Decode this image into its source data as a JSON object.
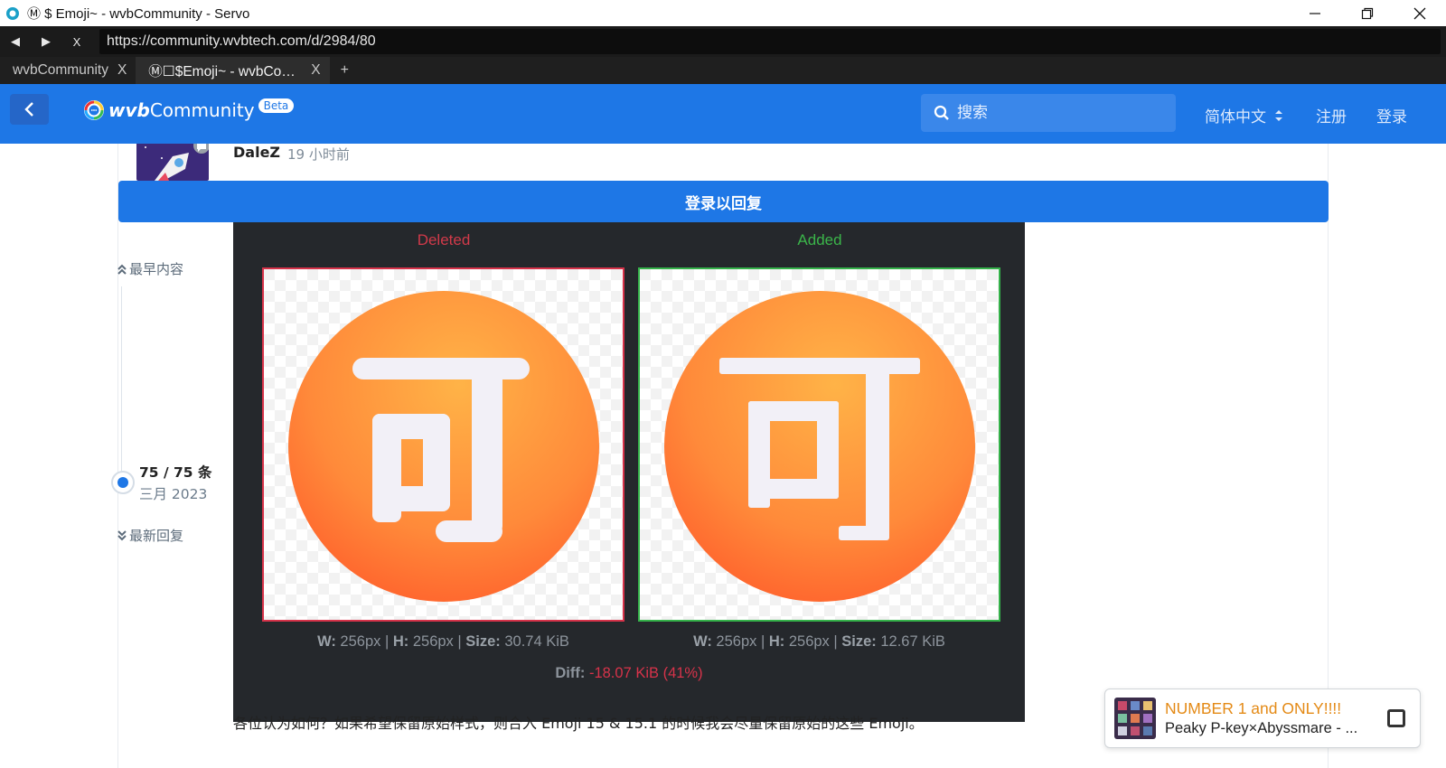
{
  "window": {
    "title": "Ⓜ $ Emoji~ - wvbCommunity - Servo"
  },
  "toolbar": {
    "back": "◀",
    "forward": "▶",
    "stop": "X",
    "url": "https://community.wvbtech.com/d/2984/80"
  },
  "tabs": [
    {
      "label": "wvbCommunity",
      "close": "X",
      "active": false
    },
    {
      "label": "Ⓜ☐$Emoji~ - wvbCommunity - Servo",
      "close": "X",
      "active": true
    }
  ],
  "newtab": "+",
  "header": {
    "logo_wvb": "wvb",
    "logo_community": "Community",
    "beta": "Beta",
    "search_placeholder": "搜索",
    "language": "简体中文",
    "register": "注册",
    "login": "登录",
    "accent": "#1e77e6"
  },
  "post": {
    "username": "DaleZ",
    "time": "19 小时前",
    "reply_button": "登录以回复",
    "body": "各位认为如何？如果希望保留原始样式，则合入 Emoji 15 & 15.1 的时候我会尽量保留原始的这些 Emoji。"
  },
  "scrubber": {
    "earliest": "最早内容",
    "count": "75 / 75 条",
    "date": "三月 2023",
    "latest": "最新回复",
    "position": 1.0
  },
  "diff": {
    "deleted_label": "Deleted",
    "added_label": "Added",
    "deleted_meta_w": "W:",
    "deleted_meta_w_val": " 256px | ",
    "deleted_meta_h": "H:",
    "deleted_meta_h_val": " 256px | ",
    "deleted_meta_s": "Size:",
    "deleted_meta_s_val": " 30.74 KiB",
    "added_meta_w": "W:",
    "added_meta_w_val": " 256px | ",
    "added_meta_h": "H:",
    "added_meta_h_val": " 256px | ",
    "added_meta_s": "Size:",
    "added_meta_s_val": " 12.67 KiB",
    "diff_label": "Diff:",
    "diff_value": " -18.07 KiB (41%)",
    "glyph": "可"
  },
  "notification": {
    "title": "NUMBER 1 and ONLY!!!!",
    "subtitle": "Peaky P-key×Abyssmare - ..."
  }
}
